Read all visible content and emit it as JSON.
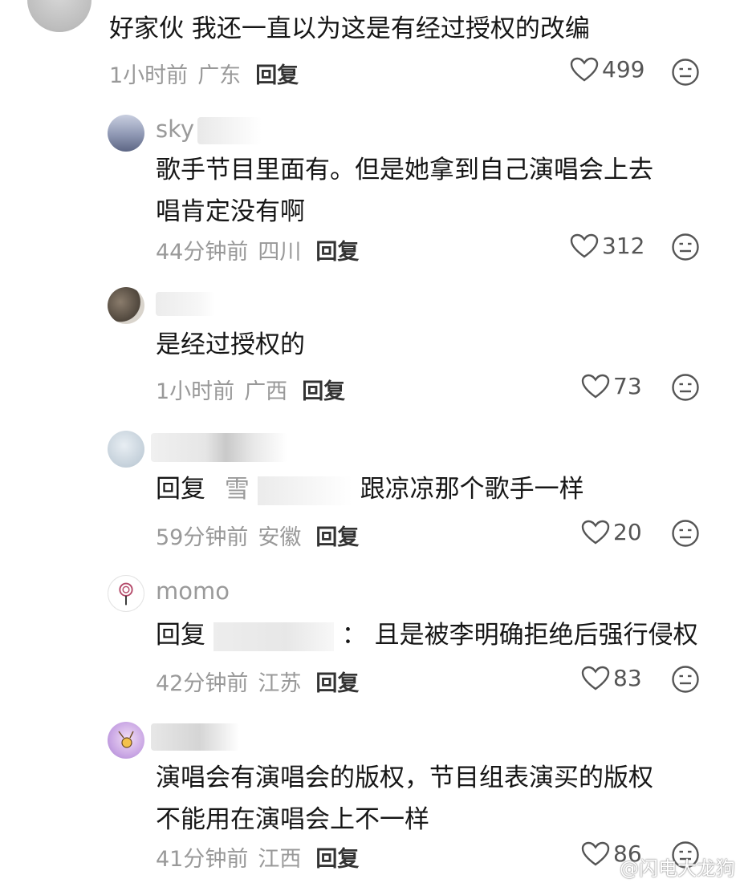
{
  "comments": [
    {
      "username": "",
      "text_lines": [
        "好家伙 我还一直以为这是有经过授权的改编"
      ],
      "time": "1小时前",
      "location": "广东",
      "reply_label": "回复",
      "likes": "499"
    },
    {
      "username": "sky",
      "text_lines": [
        "歌手节目里面有。但是她拿到自己演唱会上去",
        "唱肯定没有啊"
      ],
      "time": "44分钟前",
      "location": "四川",
      "reply_label": "回复",
      "likes": "312"
    },
    {
      "username": "",
      "text_lines": [
        "是经过授权的"
      ],
      "time": "1小时前",
      "location": "广西",
      "reply_label": "回复",
      "likes": "73"
    },
    {
      "username": "",
      "text_prefix": "回复",
      "text_mention": "雪",
      "text_body": "跟凉凉那个歌手一样",
      "time": "59分钟前",
      "location": "安徽",
      "reply_label": "回复",
      "likes": "20"
    },
    {
      "username": "momo",
      "text_prefix": "回复",
      "text_body": "：  且是被李明确拒绝后强行侵权",
      "time": "42分钟前",
      "location": "江苏",
      "reply_label": "回复",
      "likes": "83"
    },
    {
      "username": "",
      "text_lines": [
        "演唱会有演唱会的版权，节目组表演买的版权",
        "不能用在演唱会上不一样"
      ],
      "time": "41分钟前",
      "location": "江西",
      "reply_label": "回复",
      "likes": "86"
    }
  ],
  "watermark": "@闪电大龙狗",
  "icons": {
    "like": "heart-outline-icon",
    "dislike": "meh-face-icon"
  }
}
